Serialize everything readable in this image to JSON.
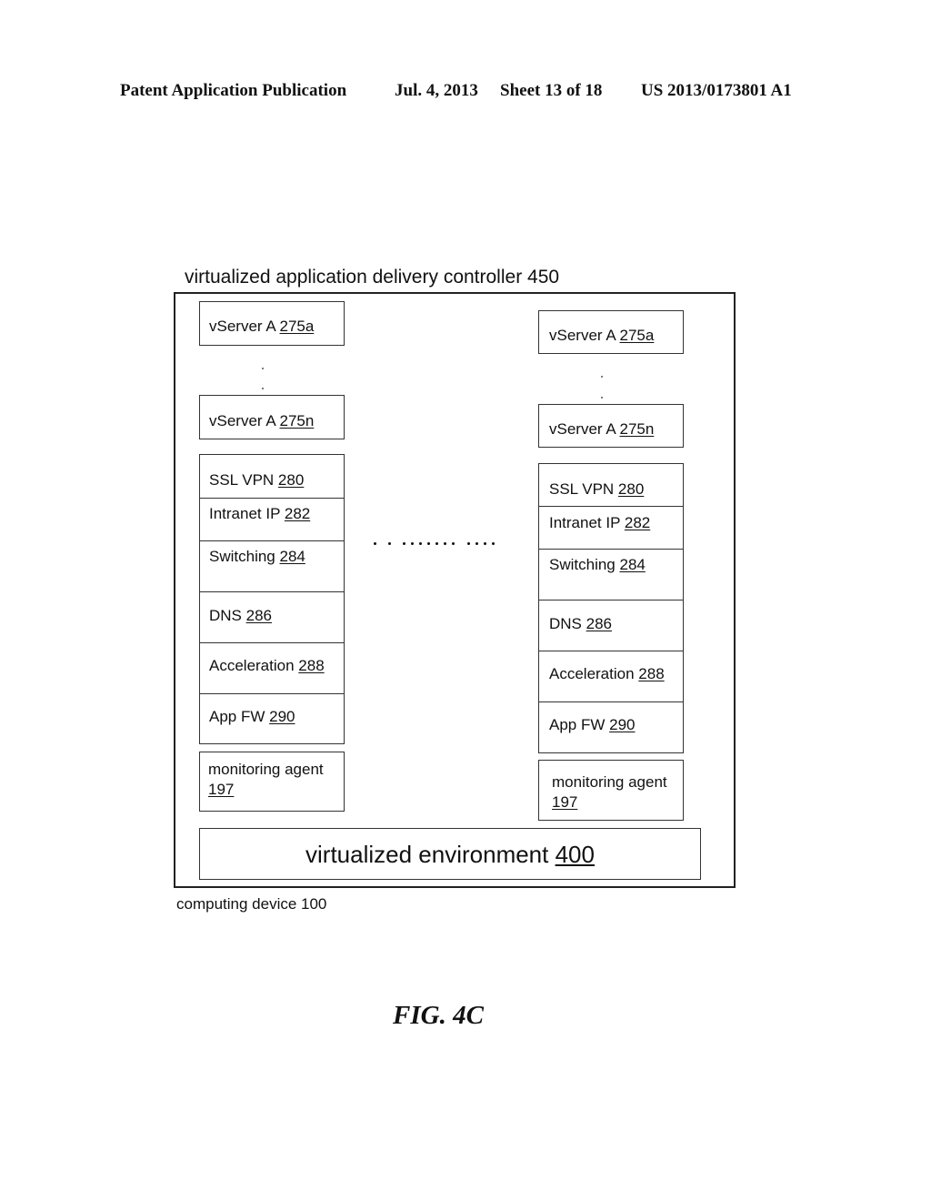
{
  "header": {
    "publication": "Patent Application Publication",
    "date": "Jul. 4, 2013",
    "sheet": "Sheet 13 of 18",
    "number": "US 2013/0173801 A1"
  },
  "diagram": {
    "controller_label": "virtualized application delivery controller 450",
    "device_label": "computing device 100",
    "environment": {
      "text": "virtualized environment ",
      "ref": "400"
    },
    "columns": [
      {
        "vserver_first": {
          "text": "vServer A ",
          "ref": "275a"
        },
        "vserver_last": {
          "text": "vServer A ",
          "ref": "275n"
        },
        "modules": [
          {
            "text": "SSL VPN ",
            "ref": "280"
          },
          {
            "text": "Intranet IP ",
            "ref": "282"
          },
          {
            "text": "Switching ",
            "ref": "284"
          },
          {
            "text": "DNS ",
            "ref": "286"
          },
          {
            "text": "Acceleration ",
            "ref": "288"
          },
          {
            "text": "App FW ",
            "ref": "290"
          }
        ],
        "agent": {
          "text": "monitoring agent",
          "ref": "197"
        }
      },
      {
        "vserver_first": {
          "text": "vServer A ",
          "ref": "275a"
        },
        "vserver_last": {
          "text": "vServer A ",
          "ref": "275n"
        },
        "modules": [
          {
            "text": "SSL VPN ",
            "ref": "280"
          },
          {
            "text": "Intranet IP ",
            "ref": "282"
          },
          {
            "text": "Switching ",
            "ref": "284"
          },
          {
            "text": "DNS ",
            "ref": "286"
          },
          {
            "text": "Acceleration ",
            "ref": "288"
          },
          {
            "text": "App FW ",
            "ref": "290"
          }
        ],
        "agent": {
          "text": "monitoring agent",
          "ref": "197"
        }
      }
    ]
  },
  "figure_label": "FIG. 4C"
}
